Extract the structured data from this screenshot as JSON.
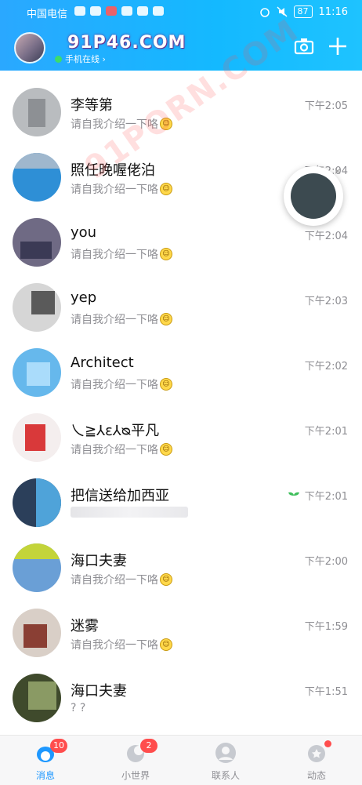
{
  "status_bar": {
    "carrier": "中国电信",
    "time": "11:16",
    "battery": "87"
  },
  "header": {
    "nickname": "91P46.COM",
    "online_status": "手机在线 ›",
    "accent_color": "#1ab4ff"
  },
  "watermark": "91PORN.COM",
  "conversations": [
    {
      "name": "李等第",
      "preview": "请自我介绍一下咯",
      "time": "下午2:05"
    },
    {
      "name": "照任晚喔佬泊",
      "preview": "请自我介绍一下咯",
      "time": "下午2:04"
    },
    {
      "name": "you",
      "preview": "请自我介绍一下咯",
      "time": "下午2:04"
    },
    {
      "name": "yep",
      "preview": "请自我介绍一下咯",
      "time": "下午2:03"
    },
    {
      "name": "Architect",
      "preview": "请自我介绍一下咯",
      "time": "下午2:02"
    },
    {
      "name": "乀≧⅄ɛ⅄ᴓ平凡",
      "preview": "请自我介绍一下咯",
      "time": "下午2:01"
    },
    {
      "name": "把信送给加西亚",
      "preview": "",
      "time": "下午2:01"
    },
    {
      "name": "海口夫妻",
      "preview": "请自我介绍一下咯",
      "time": "下午2:00"
    },
    {
      "name": "迷雾",
      "preview": "请自我介绍一下咯",
      "time": "下午1:59"
    },
    {
      "name": "海口夫妻",
      "preview": "? ?",
      "time": "下午1:51"
    }
  ],
  "tabbar": {
    "messages": {
      "label": "消息",
      "badge": "10"
    },
    "world": {
      "label": "小世界",
      "badge": "2"
    },
    "contacts": {
      "label": "联系人"
    },
    "moments": {
      "label": "动态"
    }
  }
}
